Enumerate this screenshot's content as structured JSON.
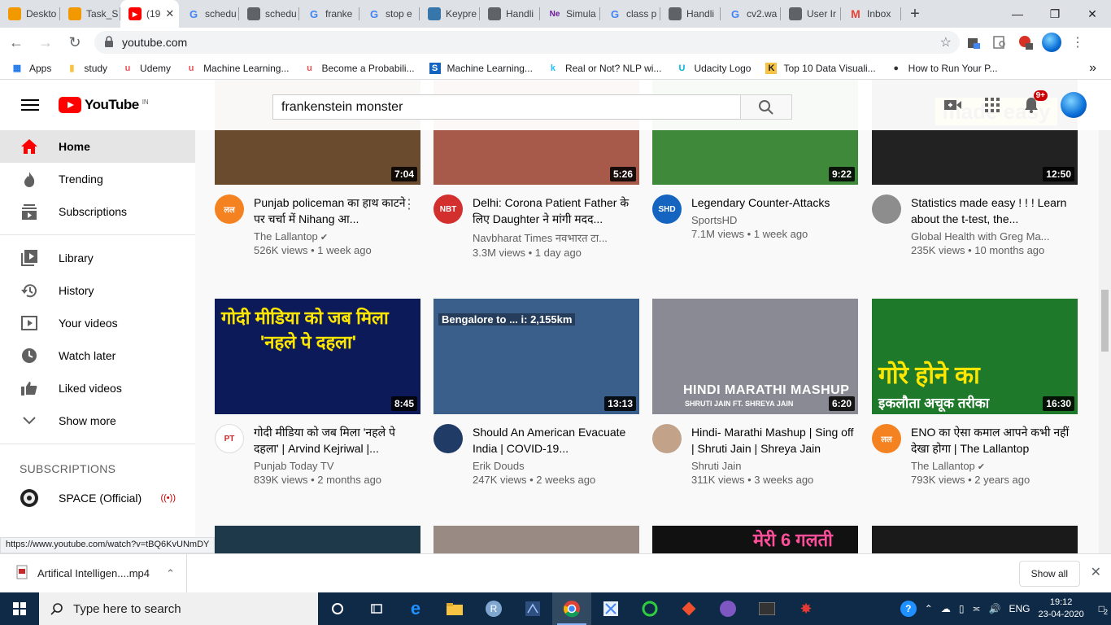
{
  "browser": {
    "tabs": [
      {
        "label": "Deskto",
        "icon": "orange-doc",
        "color": "#f29900"
      },
      {
        "label": "Task_S",
        "icon": "orange-doc",
        "color": "#f29900"
      },
      {
        "label": "(19",
        "icon": "youtube",
        "color": "#ff0000",
        "active": true
      },
      {
        "label": "schedu",
        "icon": "google",
        "color": "#4285f4"
      },
      {
        "label": "schedu",
        "icon": "doc",
        "color": "#5f6368"
      },
      {
        "label": "franke",
        "icon": "google",
        "color": "#4285f4"
      },
      {
        "label": "stop e",
        "icon": "google",
        "color": "#4285f4"
      },
      {
        "label": "Keypre",
        "icon": "python",
        "color": "#3776ab"
      },
      {
        "label": "Handli",
        "icon": "globe",
        "color": "#5f6368"
      },
      {
        "label": "Simula",
        "icon": "ne",
        "color": "#6a1b9a"
      },
      {
        "label": "class p",
        "icon": "google",
        "color": "#4285f4"
      },
      {
        "label": "Handli",
        "icon": "doc",
        "color": "#5f6368"
      },
      {
        "label": "cv2.wa",
        "icon": "google",
        "color": "#4285f4"
      },
      {
        "label": "User Ir",
        "icon": "globe",
        "color": "#5f6368"
      },
      {
        "label": "Inbox",
        "icon": "gmail",
        "color": "#ea4335"
      }
    ],
    "url": "youtube.com",
    "bookmarks": [
      {
        "label": "Apps",
        "icon": "apps"
      },
      {
        "label": "study",
        "icon": "folder"
      },
      {
        "label": "Udemy",
        "icon": "udemy"
      },
      {
        "label": "Machine Learning...",
        "icon": "udemy"
      },
      {
        "label": "Become a Probabili...",
        "icon": "udemy"
      },
      {
        "label": "Machine Learning...",
        "icon": "s"
      },
      {
        "label": "Real or Not? NLP wi...",
        "icon": "k"
      },
      {
        "label": "Udacity Logo",
        "icon": "udacity"
      },
      {
        "label": "Top 10 Data Visuali...",
        "icon": "k-yellow"
      },
      {
        "label": "How to Run Your P...",
        "icon": "github"
      }
    ],
    "bookmarks_more": "»",
    "status_url": "https://www.youtube.com/watch?v=tBQ6KvUNmDY"
  },
  "youtube": {
    "logo_text": "YouTube",
    "country": "IN",
    "search_value": "frankenstein monster",
    "notifications": "9+",
    "sidebar": {
      "items": [
        {
          "label": "Home",
          "icon": "home-icon",
          "active": true
        },
        {
          "label": "Trending",
          "icon": "flame-icon"
        },
        {
          "label": "Subscriptions",
          "icon": "subscriptions-icon"
        }
      ],
      "library": [
        {
          "label": "Library",
          "icon": "library-icon"
        },
        {
          "label": "History",
          "icon": "history-icon"
        },
        {
          "label": "Your videos",
          "icon": "your-videos-icon"
        },
        {
          "label": "Watch later",
          "icon": "clock-icon"
        },
        {
          "label": "Liked videos",
          "icon": "thumbs-up-icon"
        },
        {
          "label": "Show more",
          "icon": "chevron-down-icon"
        }
      ],
      "subscriptions_heading": "SUBSCRIPTIONS",
      "subscriptions": [
        {
          "label": "SPACE (Official)",
          "live": "((•))"
        }
      ]
    },
    "videos": [
      {
        "title": "Punjab policeman का हाथ काटने पर चर्चा में Nihang आ...",
        "channel": "The Lallantop",
        "verified": true,
        "stats": "526K views • 1 week ago",
        "duration": "7:04",
        "thumb": "#6b4b2e",
        "avatar": "#f58220",
        "avatar_text": "लल"
      },
      {
        "title": "Delhi: Corona Patient Father के लिए Daughter ने मांगी मदद...",
        "channel": "Navbharat Times नवभारत टा...",
        "verified": false,
        "stats": "3.3M views • 1 day ago",
        "duration": "5:26",
        "thumb": "#a85a4a",
        "avatar": "#d32f2f",
        "avatar_text": "NBT"
      },
      {
        "title": "Legendary Counter-Attacks",
        "channel": "SportsHD",
        "verified": false,
        "stats": "7.1M views • 1 week ago",
        "duration": "9:22",
        "thumb": "#3f8a3a",
        "avatar": "#1565c0",
        "avatar_text": "SHD"
      },
      {
        "title": "Statistics made easy ! ! ! Learn about the t-test, the...",
        "channel": "Global Health with Greg Ma...",
        "verified": false,
        "stats": "235K views • 10 months ago",
        "duration": "12:50",
        "thumb": "#222222",
        "avatar": "#8d8d8d",
        "avatar_text": ""
      },
      {
        "title": "गोदी मीडिया को जब मिला 'नहले पे दहला' | Arvind Kejriwal |...",
        "channel": "Punjab Today TV",
        "verified": false,
        "stats": "839K views • 2 months ago",
        "duration": "8:45",
        "thumb": "#0d1a5a",
        "avatar": "#ffffff",
        "avatar_text": "PT"
      },
      {
        "title": "Should An American Evacuate India | COVID-19...",
        "channel": "Erik Douds",
        "verified": false,
        "stats": "247K views • 2 weeks ago",
        "duration": "13:13",
        "thumb": "#3a5f8a",
        "avatar": "#1f3b66",
        "avatar_text": ""
      },
      {
        "title": "Hindi- Marathi Mashup | Sing off | Shruti Jain | Shreya Jain",
        "channel": "Shruti Jain",
        "verified": false,
        "stats": "311K views • 3 weeks ago",
        "duration": "6:20",
        "thumb": "#8a8a94",
        "avatar": "#c2a38a",
        "avatar_text": ""
      },
      {
        "title": "ENO का ऐसा कमाल आपने कभी नहीं देखा होगा | The Lallantop",
        "channel": "The Lallantop",
        "verified": true,
        "stats": "793K views • 2 years ago",
        "duration": "16:30",
        "thumb": "#1e7a2a",
        "avatar": "#f58220",
        "avatar_text": "लल"
      }
    ],
    "thumb_texts": {
      "v3": "made easy",
      "v4a": "गोदी मीडिया को जब मिला",
      "v4b": "'नहले पे दहला'",
      "v5": "Bengalore to ... i: 2,155km",
      "v6a": "HINDI MARATHI MASHUP",
      "v6b": "SHRUTI JAIN FT. SHREYA JAIN",
      "v7a": "गोरे होने का",
      "v7b": "इकलौता अचूक तरीका",
      "r3c": "मेरी 6 गलती"
    }
  },
  "download": {
    "file": "Artifical Intelligen....mp4",
    "show_all": "Show all"
  },
  "taskbar": {
    "search_placeholder": "Type here to search",
    "lang": "ENG",
    "time": "19:12",
    "date": "23-04-2020",
    "notif_count": "2"
  }
}
